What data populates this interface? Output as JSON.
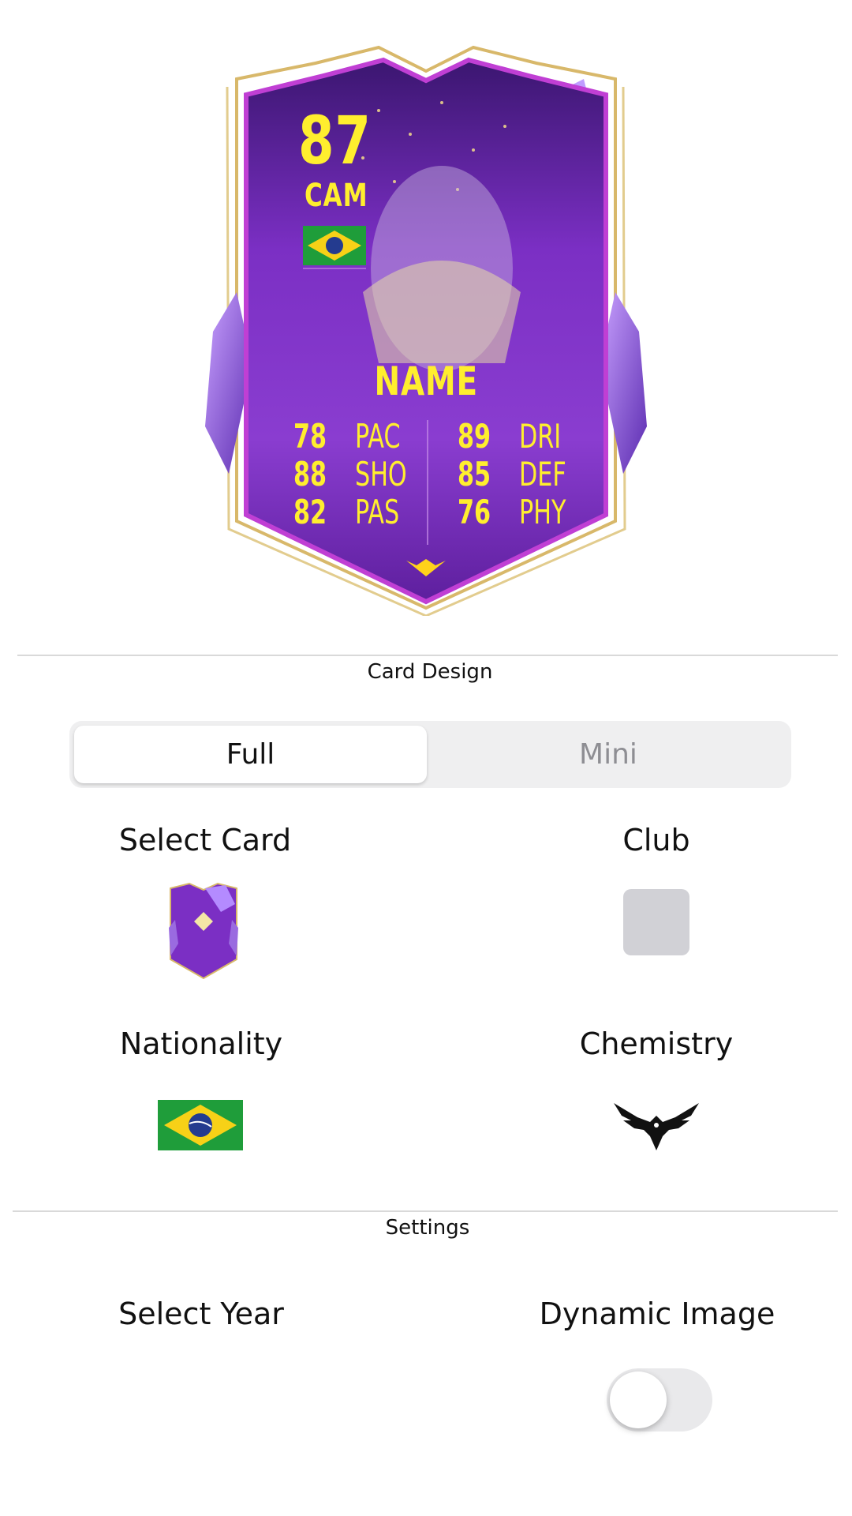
{
  "card": {
    "rating": "87",
    "position": "CAM",
    "name": "NAME",
    "stats": [
      {
        "value": "78",
        "label": "PAC"
      },
      {
        "value": "88",
        "label": "SHO"
      },
      {
        "value": "82",
        "label": "PAS"
      },
      {
        "value": "89",
        "label": "DRI"
      },
      {
        "value": "85",
        "label": "DEF"
      },
      {
        "value": "76",
        "label": "PHY"
      }
    ],
    "nation_flag": "brazil-flag-icon",
    "chemistry_icon": "eagle-icon"
  },
  "card_design": {
    "section_title": "Card Design",
    "tabs": [
      {
        "label": "Full",
        "selected": true
      },
      {
        "label": "Mini",
        "selected": false
      }
    ],
    "select_card_label": "Select Card",
    "club_label": "Club",
    "nationality_label": "Nationality",
    "chemistry_label": "Chemistry"
  },
  "settings": {
    "section_title": "Settings",
    "select_year_label": "Select Year",
    "dynamic_image_label": "Dynamic Image",
    "dynamic_image_on": false
  },
  "colors": {
    "card_purple": "#7a2bbf",
    "card_gold": "#d8b86a",
    "stat_yellow": "#ffee2e",
    "toggle_off": "#e9e9eb",
    "club_placeholder": "#d1d1d6"
  }
}
